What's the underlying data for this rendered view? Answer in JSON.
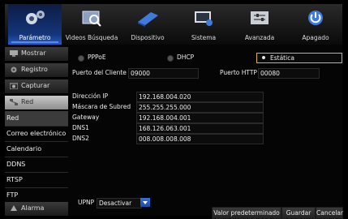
{
  "tabs": [
    {
      "label": "Parámetro",
      "icon": "gears-icon",
      "active": true
    },
    {
      "label": "Videos Búsqueda",
      "icon": "video-search-icon",
      "active": false
    },
    {
      "label": "Dispositivo",
      "icon": "disk-icon",
      "active": false
    },
    {
      "label": "Sistema",
      "icon": "system-icon",
      "active": false
    },
    {
      "label": "Avanzada",
      "icon": "advanced-icon",
      "active": false
    },
    {
      "label": "Apagado",
      "icon": "power-icon",
      "active": false
    }
  ],
  "sidebar": {
    "buttons": [
      {
        "label": "Mostrar",
        "icon": "monitor-icon"
      },
      {
        "label": "Registro",
        "icon": "record-icon"
      },
      {
        "label": "Capturar",
        "icon": "capture-icon"
      },
      {
        "label": "Red",
        "icon": "network-icon"
      }
    ],
    "items": [
      "Red",
      "Correo electrónico",
      "Calendario",
      "DDNS",
      "RTSP",
      "FTP"
    ],
    "bottom_button": {
      "label": "Alarma",
      "icon": "alarm-icon"
    }
  },
  "network": {
    "modes": [
      "PPPoE",
      "DHCP",
      "Estática"
    ],
    "selected_mode": "Estática",
    "client_port_label": "Puerto del Cliente",
    "client_port": "09000",
    "http_port_label": "Puerto HTTP",
    "http_port": "00080",
    "fields": [
      {
        "label": "Dirección IP",
        "value": "192.168.004.020"
      },
      {
        "label": "Máscara de Subred",
        "value": "255.255.255.000"
      },
      {
        "label": "Gateway",
        "value": "192.168.004.001"
      },
      {
        "label": "DNS1",
        "value": "168.126.063.001"
      },
      {
        "label": "DNS2",
        "value": "008.008.008.008"
      }
    ],
    "upnp_label": "UPNP",
    "upnp_value": "Desactivar"
  },
  "buttons": {
    "default": "Valor predeterminado",
    "save": "Guardar",
    "cancel": "Cancelar"
  },
  "colors": {
    "accent": "#2a5bc4",
    "highlight": "#d8b63c"
  }
}
